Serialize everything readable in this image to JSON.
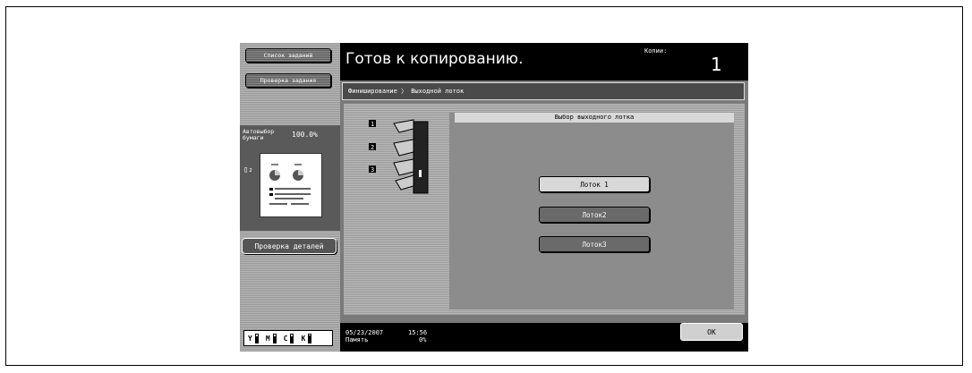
{
  "sidebar": {
    "job_list_label": "Список заданий",
    "job_check_label": "Проверка задания",
    "paper_label": "Автовыбор бумаги",
    "zoom": "100.0%",
    "detail_check_label": "Проверка деталей",
    "toner": [
      "Y",
      "M",
      "C",
      "K"
    ]
  },
  "header": {
    "status": "Готов к копированию.",
    "copies_label": "Копии:",
    "copies_value": "1"
  },
  "breadcrumb": "Финиширование 〉 Выходной лоток",
  "panel": {
    "title": "Выбор выходного лотка",
    "trays": [
      "Лоток 1",
      "Лоток2",
      "Лоток3"
    ],
    "tray_numbers": [
      "1",
      "2",
      "3"
    ]
  },
  "footer": {
    "date": "05/23/2007",
    "time": "15:56",
    "memory_label": "Память",
    "memory_value": "0%",
    "ok_label": "OK"
  }
}
